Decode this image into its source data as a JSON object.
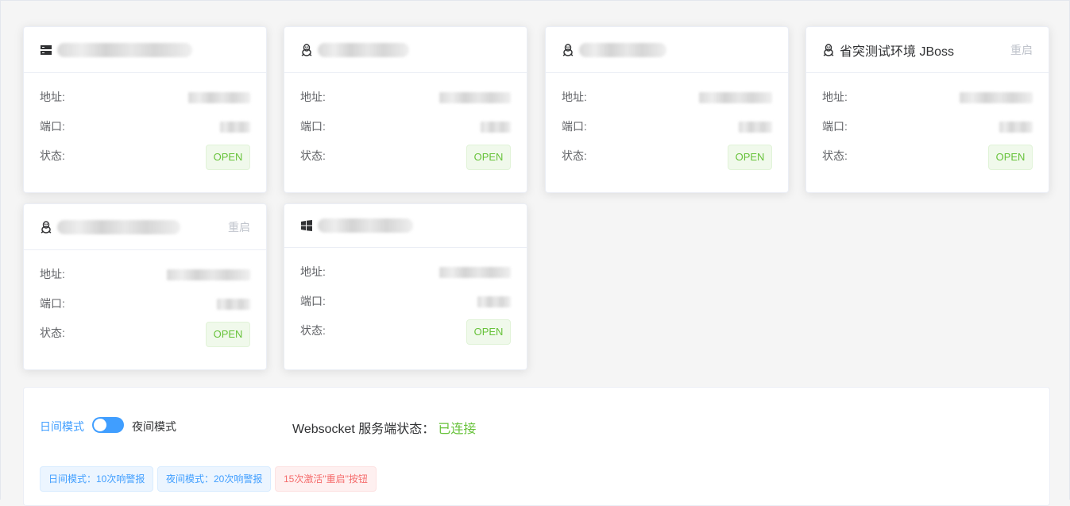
{
  "labels": {
    "address": "地址:",
    "port": "端口:",
    "status": "状态:",
    "restart": "重启"
  },
  "servers": [
    {
      "os": "server-icon",
      "name": "",
      "address": "",
      "port": "",
      "status": "OPEN",
      "show_restart": false
    },
    {
      "os": "linux-icon",
      "name": "",
      "address": "",
      "port": "",
      "status": "OPEN",
      "show_restart": false
    },
    {
      "os": "linux-icon",
      "name": "",
      "address": "",
      "port": "",
      "status": "OPEN",
      "show_restart": false
    },
    {
      "os": "linux-icon",
      "name": "省突测试环境 JBoss",
      "address": "",
      "port": "",
      "status": "OPEN",
      "show_restart": true
    },
    {
      "os": "linux-icon",
      "name": "",
      "address": "",
      "port": "",
      "status": "OPEN",
      "show_restart": true
    },
    {
      "os": "windows-icon",
      "name": "",
      "address": "",
      "port": "",
      "status": "OPEN",
      "show_restart": false
    }
  ],
  "panel": {
    "day_mode": "日间模式",
    "night_mode": "夜间模式",
    "ws_label": "Websocket 服务端状态：",
    "ws_status": "已连接",
    "tags": {
      "day": "日间模式：10次响警报",
      "night": "夜间模式：20次响警报",
      "restart": "15次激活\"重启\"按钮"
    }
  },
  "colors": {
    "primary": "#409eff",
    "success": "#67c23a",
    "danger": "#f56c6c"
  }
}
